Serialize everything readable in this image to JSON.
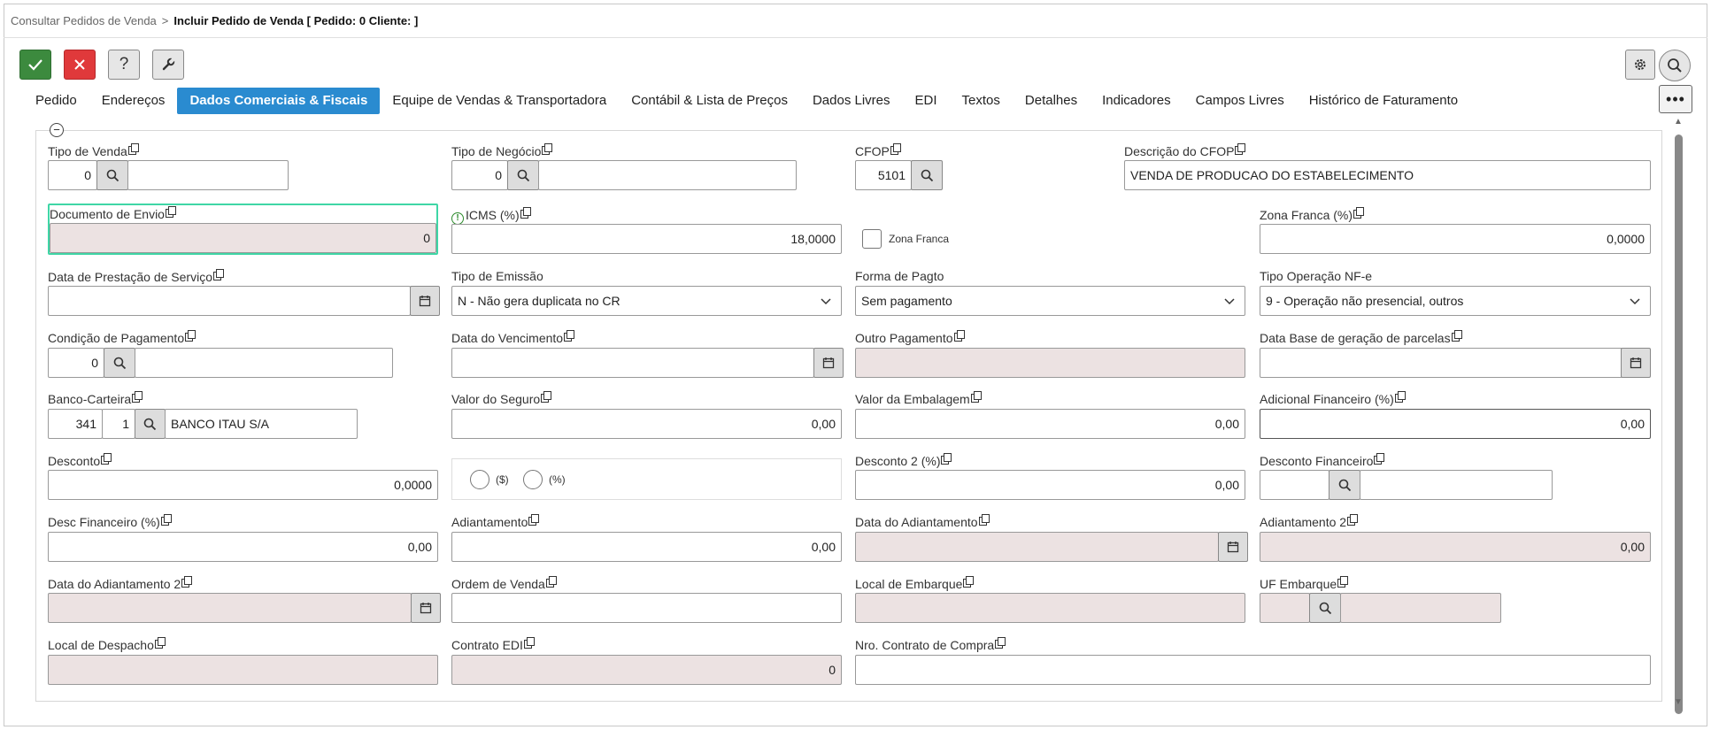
{
  "breadcrumb": {
    "parent": "Consultar Pedidos de Venda",
    "separator": ">",
    "current": "Incluir Pedido de Venda [ Pedido: 0 Cliente: ]"
  },
  "toolbar": {
    "help_label": "?"
  },
  "tabs": [
    {
      "label": "Pedido",
      "active": false
    },
    {
      "label": "Endereços",
      "active": false
    },
    {
      "label": "Dados Comerciais & Fiscais",
      "active": true
    },
    {
      "label": "Equipe de Vendas & Transportadora",
      "active": false
    },
    {
      "label": "Contábil & Lista de Preços",
      "active": false
    },
    {
      "label": "Dados Livres",
      "active": false
    },
    {
      "label": "EDI",
      "active": false
    },
    {
      "label": "Textos",
      "active": false
    },
    {
      "label": "Detalhes",
      "active": false
    },
    {
      "label": "Indicadores",
      "active": false
    },
    {
      "label": "Campos Livres",
      "active": false
    },
    {
      "label": "Histórico de Faturamento",
      "active": false
    }
  ],
  "colors": {
    "active_tab": "#2a8bd0",
    "ok": "#3c8a3e",
    "cancel": "#e0393b",
    "readonly": "#ece2e2",
    "focus": "#3fd6a6"
  },
  "form": {
    "tipo_venda": {
      "label": "Tipo de Venda",
      "code": "0",
      "desc": ""
    },
    "tipo_negocio": {
      "label": "Tipo de Negócio",
      "code": "0",
      "desc": ""
    },
    "cfop": {
      "label": "CFOP",
      "code": "5101"
    },
    "descricao_cfop": {
      "label": "Descrição do CFOP",
      "value": "VENDA DE PRODUCAO DO ESTABELECIMENTO"
    },
    "documento_envio": {
      "label": "Documento de Envio",
      "value": "0"
    },
    "icms": {
      "label": "ICMS (%)",
      "value": "18,0000"
    },
    "zona_franca_chk": {
      "label": "Zona Franca",
      "checked": false
    },
    "zona_franca_pct": {
      "label": "Zona Franca (%)",
      "value": "0,0000"
    },
    "data_prestacao": {
      "label": "Data de Prestação de Serviço",
      "value": ""
    },
    "tipo_emissao": {
      "label": "Tipo de Emissão",
      "value": "N - Não gera duplicata no CR"
    },
    "forma_pagto": {
      "label": "Forma de Pagto",
      "value": "Sem pagamento"
    },
    "tipo_operacao": {
      "label": "Tipo Operação NF-e",
      "value": "9 - Operação não presencial, outros"
    },
    "condicao_pagamento": {
      "label": "Condição de Pagamento",
      "code": "0",
      "desc": ""
    },
    "data_vencimento": {
      "label": "Data do Vencimento",
      "value": ""
    },
    "outro_pagamento": {
      "label": "Outro Pagamento",
      "value": ""
    },
    "data_base": {
      "label": "Data Base de geração de parcelas",
      "value": ""
    },
    "banco_carteira": {
      "label": "Banco-Carteira",
      "banco": "341",
      "carteira": "1",
      "desc": "BANCO ITAU S/A"
    },
    "valor_seguro": {
      "label": "Valor do Seguro",
      "value": "0,00"
    },
    "valor_embalagem": {
      "label": "Valor da Embalagem",
      "value": "0,00"
    },
    "adicional_financeiro": {
      "label": "Adicional Financeiro (%)",
      "value": "0,00"
    },
    "desconto": {
      "label": "Desconto",
      "value": "0,0000"
    },
    "desconto_tipo": {
      "opt1": "($)",
      "opt2": "(%)"
    },
    "desconto2": {
      "label": "Desconto 2 (%)",
      "value": "0,00"
    },
    "desconto_financeiro": {
      "label": "Desconto Financeiro",
      "code": "",
      "desc": ""
    },
    "desc_financeiro_pct": {
      "label": "Desc Financeiro (%)",
      "value": "0,00"
    },
    "adiantamento": {
      "label": "Adiantamento",
      "value": "0,00"
    },
    "data_adiantamento": {
      "label": "Data do Adiantamento",
      "value": ""
    },
    "adiantamento2": {
      "label": "Adiantamento 2",
      "value": "0,00"
    },
    "data_adiantamento2": {
      "label": "Data do Adiantamento 2",
      "value": ""
    },
    "ordem_venda": {
      "label": "Ordem de Venda",
      "value": ""
    },
    "local_embarque": {
      "label": "Local de Embarque",
      "value": ""
    },
    "uf_embarque": {
      "label": "UF Embarque",
      "code": "",
      "desc": ""
    },
    "local_despacho": {
      "label": "Local de Despacho",
      "value": ""
    },
    "contrato_edi": {
      "label": "Contrato EDI",
      "value": "0"
    },
    "nro_contrato": {
      "label": "Nro. Contrato de Compra",
      "value": ""
    }
  }
}
